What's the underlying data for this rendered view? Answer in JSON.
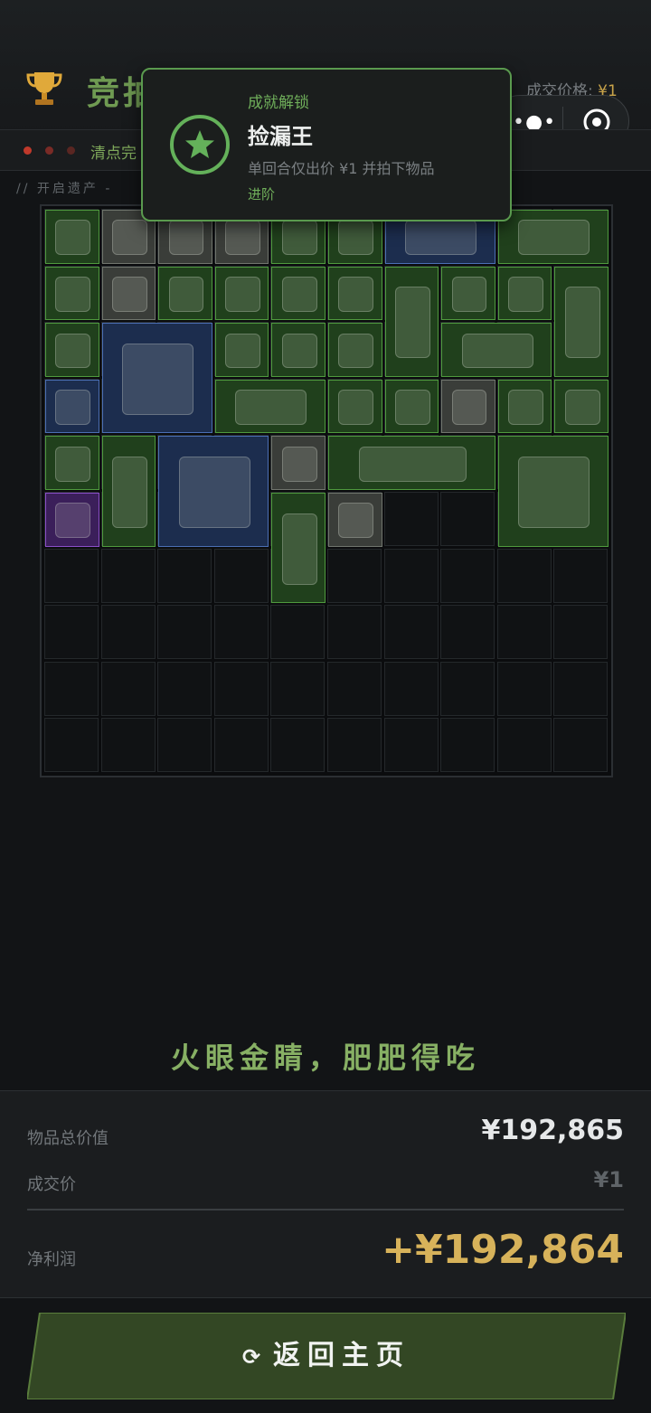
{
  "header": {
    "title": "竞拍",
    "deal_price_label": "成交价格:",
    "deal_price_value": "¥1",
    "trophy_icon": "trophy-icon",
    "menu_icon": "more-dots-icon",
    "close_icon": "target-close-icon"
  },
  "status": {
    "text": "清点完",
    "dot_colors": [
      "#c0392b",
      "#7a2b26",
      "#5a2622"
    ]
  },
  "breadcrumb": "// 开启遗产 -",
  "achievement": {
    "kicker": "成就解锁",
    "name": "捡漏王",
    "description": "单回合仅出价 ¥1 并拍下物品",
    "tier": "进阶",
    "icon": "star-icon"
  },
  "inventory": {
    "columns": 10,
    "rows": 10,
    "items": [
      {
        "name": "cable-coil",
        "rarity": "green",
        "col": 0,
        "row": 0,
        "w": 1,
        "h": 1
      },
      {
        "name": "duct-tape",
        "rarity": "gray",
        "col": 1,
        "row": 0,
        "w": 1,
        "h": 1
      },
      {
        "name": "playing-card",
        "rarity": "gray",
        "col": 2,
        "row": 0,
        "w": 1,
        "h": 1
      },
      {
        "name": "pen",
        "rarity": "gray",
        "col": 3,
        "row": 0,
        "w": 1,
        "h": 1
      },
      {
        "name": "cable-coil",
        "rarity": "green",
        "col": 4,
        "row": 0,
        "w": 1,
        "h": 1
      },
      {
        "name": "circuit-board",
        "rarity": "green",
        "col": 5,
        "row": 0,
        "w": 1,
        "h": 1
      },
      {
        "name": "tobacco-pipe",
        "rarity": "blue",
        "col": 6,
        "row": 0,
        "w": 2,
        "h": 1
      },
      {
        "name": "old-documents",
        "rarity": "green",
        "col": 8,
        "row": 0,
        "w": 2,
        "h": 1
      },
      {
        "name": "hose",
        "rarity": "green",
        "col": 0,
        "row": 1,
        "w": 1,
        "h": 1
      },
      {
        "name": "scissors",
        "rarity": "gray",
        "col": 1,
        "row": 1,
        "w": 1,
        "h": 1
      },
      {
        "name": "cpu-cooler",
        "rarity": "green",
        "col": 2,
        "row": 1,
        "w": 1,
        "h": 1
      },
      {
        "name": "good-luck-card",
        "rarity": "green",
        "col": 3,
        "row": 1,
        "w": 1,
        "h": 1
      },
      {
        "name": "coffee-jar",
        "rarity": "green",
        "col": 4,
        "row": 1,
        "w": 1,
        "h": 1
      },
      {
        "name": "battery",
        "rarity": "green",
        "col": 5,
        "row": 1,
        "w": 1,
        "h": 1
      },
      {
        "name": "coffee-bag",
        "rarity": "green",
        "col": 6,
        "row": 1,
        "w": 1,
        "h": 2
      },
      {
        "name": "bullet-lighter",
        "rarity": "green",
        "col": 7,
        "row": 1,
        "w": 1,
        "h": 1
      },
      {
        "name": "screwdriver",
        "rarity": "green",
        "col": 8,
        "row": 1,
        "w": 1,
        "h": 1
      },
      {
        "name": "display-box",
        "rarity": "green",
        "col": 9,
        "row": 1,
        "w": 1,
        "h": 2
      },
      {
        "name": "tray",
        "rarity": "green",
        "col": 0,
        "row": 2,
        "w": 1,
        "h": 1
      },
      {
        "name": "magazine",
        "rarity": "blue",
        "col": 1,
        "row": 2,
        "w": 2,
        "h": 2
      },
      {
        "name": "syringe",
        "rarity": "green",
        "col": 3,
        "row": 2,
        "w": 1,
        "h": 1
      },
      {
        "name": "water-bottle",
        "rarity": "green",
        "col": 4,
        "row": 2,
        "w": 1,
        "h": 1
      },
      {
        "name": "power-bank",
        "rarity": "green",
        "col": 5,
        "row": 2,
        "w": 1,
        "h": 1
      },
      {
        "name": "keyboard",
        "rarity": "green",
        "col": 7,
        "row": 2,
        "w": 2,
        "h": 1
      },
      {
        "name": "tea-tin",
        "rarity": "blue",
        "col": 0,
        "row": 3,
        "w": 1,
        "h": 1
      },
      {
        "name": "old-map",
        "rarity": "green",
        "col": 3,
        "row": 3,
        "w": 2,
        "h": 1
      },
      {
        "name": "battery",
        "rarity": "green",
        "col": 5,
        "row": 3,
        "w": 1,
        "h": 1
      },
      {
        "name": "wrench",
        "rarity": "green",
        "col": 6,
        "row": 3,
        "w": 1,
        "h": 1
      },
      {
        "name": "playing-card",
        "rarity": "gray",
        "col": 7,
        "row": 3,
        "w": 1,
        "h": 1
      },
      {
        "name": "smart-speaker",
        "rarity": "green",
        "col": 8,
        "row": 3,
        "w": 1,
        "h": 1
      },
      {
        "name": "power-strip",
        "rarity": "green",
        "col": 9,
        "row": 3,
        "w": 1,
        "h": 1
      },
      {
        "name": "tweezers",
        "rarity": "green",
        "col": 0,
        "row": 4,
        "w": 1,
        "h": 1
      },
      {
        "name": "display-box",
        "rarity": "green",
        "col": 1,
        "row": 4,
        "w": 1,
        "h": 2
      },
      {
        "name": "tablet",
        "rarity": "blue",
        "col": 2,
        "row": 4,
        "w": 2,
        "h": 2
      },
      {
        "name": "tape-measure",
        "rarity": "gray",
        "col": 4,
        "row": 4,
        "w": 1,
        "h": 1
      },
      {
        "name": "hand-saw",
        "rarity": "green",
        "col": 5,
        "row": 4,
        "w": 3,
        "h": 1
      },
      {
        "name": "beach-poster",
        "rarity": "green",
        "col": 8,
        "row": 4,
        "w": 2,
        "h": 2
      },
      {
        "name": "chip",
        "rarity": "purple",
        "col": 0,
        "row": 5,
        "w": 1,
        "h": 1
      },
      {
        "name": "spray-can",
        "rarity": "green",
        "col": 4,
        "row": 5,
        "w": 1,
        "h": 2
      },
      {
        "name": "playing-card",
        "rarity": "gray",
        "col": 5,
        "row": 5,
        "w": 1,
        "h": 1
      }
    ]
  },
  "motto": "火眼金睛，肥肥得吃",
  "summary": {
    "total_value_label": "物品总价值",
    "total_value": "¥192,865",
    "deal_price_label": "成交价",
    "deal_price": "¥1",
    "profit_label": "净利润",
    "profit": "+¥192,864"
  },
  "home_button": {
    "label": "返回主页",
    "icon": "refresh-icon"
  },
  "colors": {
    "accent_green": "#6fae5a",
    "gold": "#d7b25a",
    "rarity_green": "#4f9a3e",
    "rarity_blue": "#4b6fb4",
    "rarity_purple": "#8a4fc8",
    "rarity_gray": "#70756d"
  }
}
